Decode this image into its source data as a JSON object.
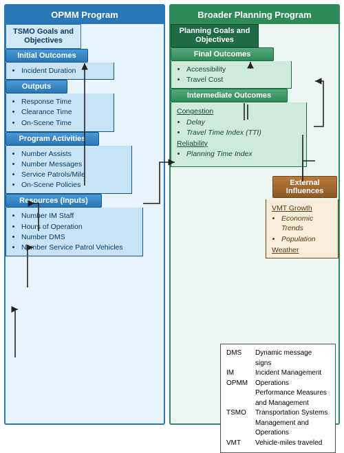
{
  "left": {
    "title": "OPMM Program",
    "goal": "TSMO Goals and Objectives",
    "initial": {
      "header": "Initial Outcomes",
      "items": [
        "Incident Duration"
      ]
    },
    "outputs": {
      "header": "Outputs",
      "items": [
        "Response Time",
        "Clearance Time",
        "On-Scene Time"
      ]
    },
    "activities": {
      "header": "Program Activities",
      "items": [
        "Number Assists",
        "Number Messages",
        "Service Patrols/Mile",
        "On-Scene Policies"
      ]
    },
    "resources": {
      "header": "Resources (Inputs)",
      "items": [
        "Number IM Staff",
        "Hours of Operation",
        "Number DMS",
        "Number Service Patrol Vehicles"
      ]
    }
  },
  "right": {
    "title": "Broader Planning Program",
    "goal": "Planning Goals and Objectives",
    "final": {
      "header": "Final Outcomes",
      "items": [
        "Accessibility",
        "Travel Cost"
      ]
    },
    "intermediate": {
      "header": "Intermediate Outcomes",
      "groups": [
        {
          "label": "Congestion",
          "items": [
            "Delay",
            "Travel Time Index (TTI)"
          ]
        },
        {
          "label": "Reliability",
          "items": [
            "Planning Time Index"
          ]
        }
      ]
    },
    "external": {
      "header": "External Influences",
      "groups": [
        {
          "label": "VMT Growth",
          "items": [
            "Economic Trends",
            "Population"
          ]
        },
        {
          "label": "Weather",
          "items": []
        }
      ]
    }
  },
  "legend": [
    {
      "abbr": "DMS",
      "def": "Dynamic message signs"
    },
    {
      "abbr": "IM",
      "def": "Incident Management"
    },
    {
      "abbr": "OPMM",
      "def": "Operations Performance Measures and Management"
    },
    {
      "abbr": "TSMO",
      "def": "Transportation Systems Management and Operations"
    },
    {
      "abbr": "VMT",
      "def": "Vehicle-miles traveled"
    }
  ]
}
